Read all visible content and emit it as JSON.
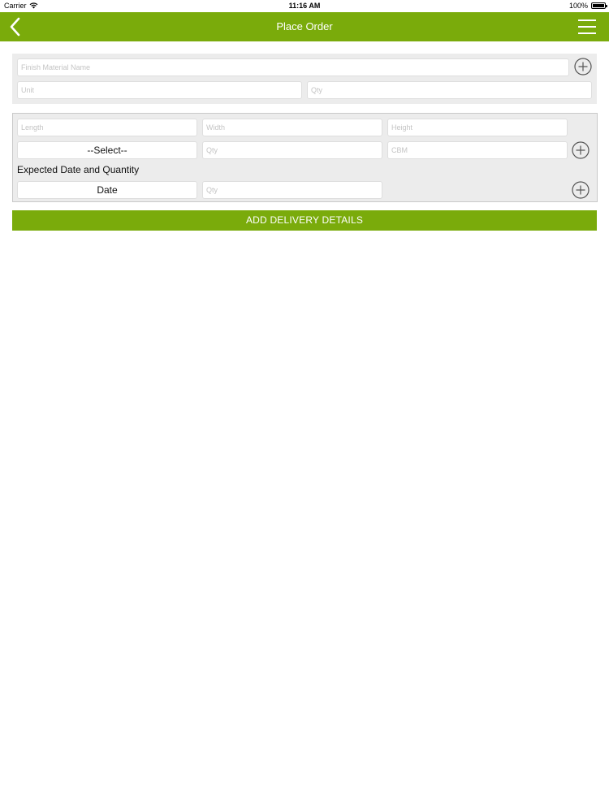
{
  "status_bar": {
    "carrier": "Carrier",
    "time": "11:16 AM",
    "battery": "100%",
    "battery_level": 1.0
  },
  "nav": {
    "title": "Place Order",
    "back_icon": "chevron-left-icon",
    "menu_icon": "hamburger-menu-icon"
  },
  "material": {
    "name_placeholder": "Finish Material Name",
    "unit_placeholder": "Unit",
    "qty_placeholder": "Qty"
  },
  "dimensions": {
    "length_placeholder": "Length",
    "width_placeholder": "Width",
    "height_placeholder": "Height",
    "select_label": "--Select--",
    "qty_placeholder": "Qty",
    "cbm_placeholder": "CBM"
  },
  "expected": {
    "label": "Expected Date and Quantity",
    "date_label": "Date",
    "qty_placeholder": "Qty"
  },
  "actions": {
    "add_delivery_label": "ADD DELIVERY DETAILS"
  },
  "colors": {
    "brand_green": "#7aab0b",
    "panel_bg": "#ececec"
  }
}
